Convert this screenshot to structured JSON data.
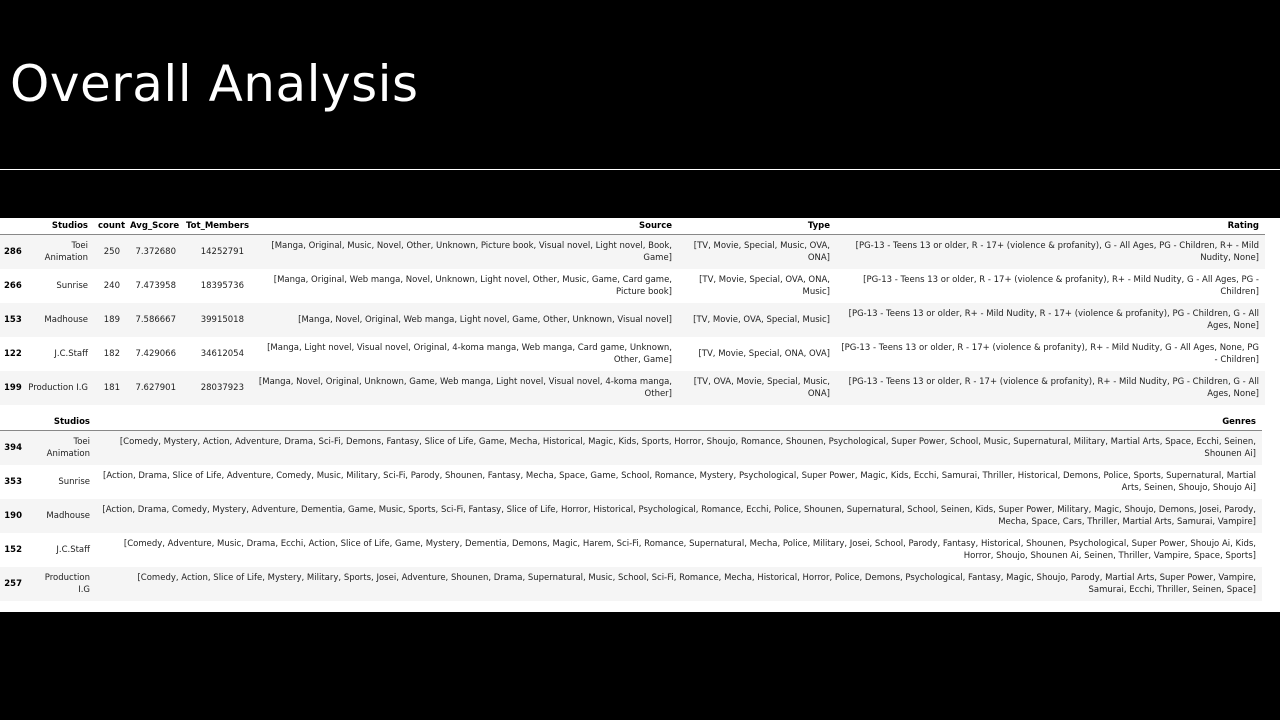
{
  "slide": {
    "title": "Overall Analysis"
  },
  "colors": {
    "background": "#000000",
    "panel": "#ffffff",
    "stripe": "#f5f5f5"
  },
  "table1": {
    "columns": [
      "",
      "Studios",
      "count",
      "Avg_Score",
      "Tot_Members",
      "Source",
      "Type",
      "Rating"
    ],
    "rows": [
      {
        "index": "286",
        "studios": "Toei Animation",
        "count": "250",
        "avg_score": "7.372680",
        "tot_members": "14252791",
        "source": "[Manga, Original, Music, Novel, Other, Unknown, Picture book, Visual novel, Light novel, Book, Game]",
        "type": "[TV, Movie, Special, Music, OVA, ONA]",
        "rating": "[PG-13 - Teens 13 or older, R - 17+ (violence & profanity), G - All Ages, PG - Children, R+ - Mild Nudity, None]"
      },
      {
        "index": "266",
        "studios": "Sunrise",
        "count": "240",
        "avg_score": "7.473958",
        "tot_members": "18395736",
        "source": "[Manga, Original, Web manga, Novel, Unknown, Light novel, Other, Music, Game, Card game, Picture book]",
        "type": "[TV, Movie, Special, OVA, ONA, Music]",
        "rating": "[PG-13 - Teens 13 or older, R - 17+ (violence & profanity), R+ - Mild Nudity, G - All Ages, PG - Children]"
      },
      {
        "index": "153",
        "studios": "Madhouse",
        "count": "189",
        "avg_score": "7.586667",
        "tot_members": "39915018",
        "source": "[Manga, Novel, Original, Web manga, Light novel, Game, Other, Unknown, Visual novel]",
        "type": "[TV, Movie, OVA, Special, Music]",
        "rating": "[PG-13 - Teens 13 or older, R+ - Mild Nudity, R - 17+ (violence & profanity), PG - Children, G - All Ages, None]"
      },
      {
        "index": "122",
        "studios": "J.C.Staff",
        "count": "182",
        "avg_score": "7.429066",
        "tot_members": "34612054",
        "source": "[Manga, Light novel, Visual novel, Original, 4-koma manga, Web manga, Card game, Unknown, Other, Game]",
        "type": "[TV, Movie, Special, ONA, OVA]",
        "rating": "[PG-13 - Teens 13 or older, R - 17+ (violence & profanity), R+ - Mild Nudity, G - All Ages, None, PG - Children]"
      },
      {
        "index": "199",
        "studios": "Production I.G",
        "count": "181",
        "avg_score": "7.627901",
        "tot_members": "28037923",
        "source": "[Manga, Novel, Original, Unknown, Game, Web manga, Light novel, Visual novel, 4-koma manga, Other]",
        "type": "[TV, OVA, Movie, Special, Music, ONA]",
        "rating": "[PG-13 - Teens 13 or older, R - 17+ (violence & profanity), R+ - Mild Nudity, PG - Children, G - All Ages, None]"
      }
    ]
  },
  "table2": {
    "columns": [
      "",
      "Studios",
      "Genres"
    ],
    "rows": [
      {
        "index": "394",
        "studios": "Toei Animation",
        "genres": "[Comedy, Mystery, Action, Adventure, Drama, Sci-Fi, Demons, Fantasy, Slice of Life, Game, Mecha, Historical, Magic, Kids, Sports, Horror, Shoujo, Romance, Shounen, Psychological, Super Power, School, Music, Supernatural, Military, Martial Arts, Space, Ecchi, Seinen, Shounen Ai]"
      },
      {
        "index": "353",
        "studios": "Sunrise",
        "genres": "[Action, Drama, Slice of Life, Adventure, Comedy, Music, Military, Sci-Fi, Parody, Shounen, Fantasy, Mecha, Space, Game, School, Romance, Mystery, Psychological, Super Power, Magic, Kids, Ecchi, Samurai, Thriller, Historical, Demons, Police, Sports, Supernatural, Martial Arts, Seinen, Shoujo, Shoujo Ai]"
      },
      {
        "index": "190",
        "studios": "Madhouse",
        "genres": "[Action, Drama, Comedy, Mystery, Adventure, Dementia, Game, Music, Sports, Sci-Fi, Fantasy, Slice of Life, Horror, Historical, Psychological, Romance, Ecchi, Police, Shounen, Supernatural, School, Seinen, Kids, Super Power, Military, Magic, Shoujo, Demons, Josei, Parody, Mecha, Space, Cars, Thriller, Martial Arts, Samurai, Vampire]"
      },
      {
        "index": "152",
        "studios": "J.C.Staff",
        "genres": "[Comedy, Adventure, Music, Drama, Ecchi, Action, Slice of Life, Game, Mystery, Dementia, Demons, Magic, Harem, Sci-Fi, Romance, Supernatural, Mecha, Police, Military, Josei, School, Parody, Fantasy, Historical, Shounen, Psychological, Super Power, Shoujo Ai, Kids, Horror, Shoujo, Shounen Ai, Seinen, Thriller, Vampire, Space, Sports]"
      },
      {
        "index": "257",
        "studios": "Production I.G",
        "genres": "[Comedy, Action, Slice of Life, Mystery, Military, Sports, Josei, Adventure, Shounen, Drama, Supernatural, Music, School, Sci-Fi, Romance, Mecha, Historical, Horror, Police, Demons, Psychological, Fantasy, Magic, Shoujo, Parody, Martial Arts, Super Power, Vampire, Samurai, Ecchi, Thriller, Seinen, Space]"
      }
    ]
  }
}
